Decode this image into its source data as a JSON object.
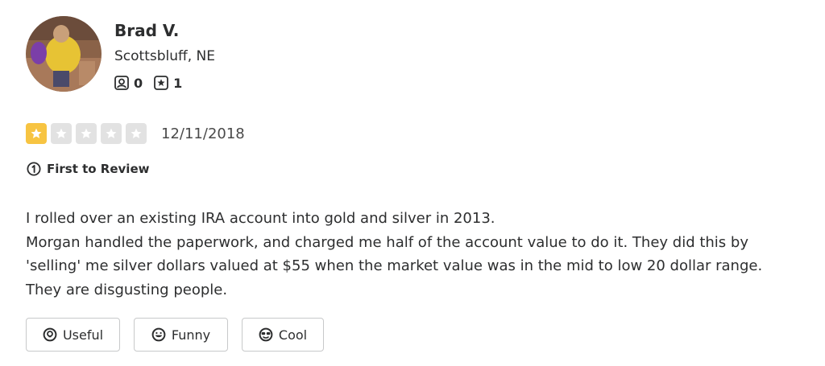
{
  "user": {
    "name": "Brad V.",
    "location": "Scottsbluff, NE",
    "friends_count": "0",
    "reviews_count": "1"
  },
  "review": {
    "rating": 1,
    "max_rating": 5,
    "date": "12/11/2018",
    "badge_label": "First to Review",
    "paragraphs": [
      "I rolled over an existing IRA account into gold and silver in 2013.",
      "Morgan handled the paperwork, and charged me half of the account value to do it. They did this by 'selling' me silver dollars valued at $55 when the market value was in the mid to low 20 dollar range.",
      "They are disgusting people."
    ]
  },
  "reactions": {
    "useful_label": "Useful",
    "funny_label": "Funny",
    "cool_label": "Cool"
  },
  "colors": {
    "star_on": "#f7c442",
    "star_off": "#e2e2e2",
    "text": "#2d2e2f",
    "border": "#c8c9ca"
  },
  "icons": {
    "friends": "friends-icon",
    "reviews": "review-star-icon",
    "first_review": "first-to-review-icon",
    "useful": "useful-lightbulb-icon",
    "funny": "funny-face-icon",
    "cool": "cool-sunglasses-icon"
  }
}
